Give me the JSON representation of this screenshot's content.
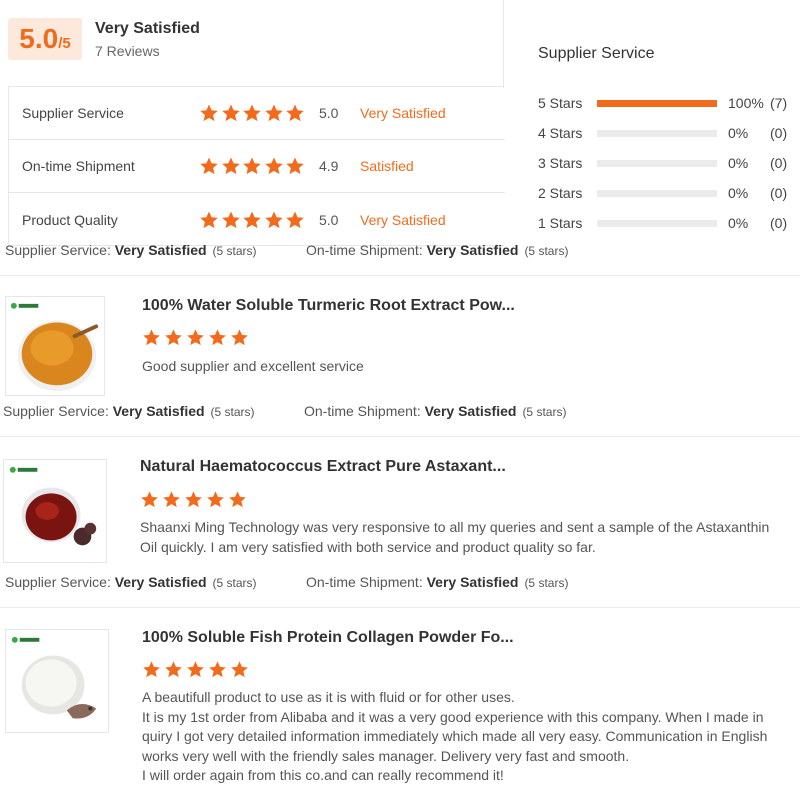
{
  "summary": {
    "score": "5.0",
    "out_of": "/5",
    "overall_label": "Very Satisfied",
    "reviews_count": "7 Reviews"
  },
  "ratings": [
    {
      "label": "Supplier Service",
      "score": "5.0",
      "status": "Very Satisfied",
      "stars": 5
    },
    {
      "label": "On-time Shipment",
      "score": "4.9",
      "status": "Satisfied",
      "stars": 5
    },
    {
      "label": "Product Quality",
      "score": "5.0",
      "status": "Very Satisfied",
      "stars": 5
    }
  ],
  "distribution": {
    "title": "Supplier Service",
    "rows": [
      {
        "label": "5 Stars",
        "fraction": 1.0,
        "pct": "100%",
        "count": "(7)"
      },
      {
        "label": "4 Stars",
        "fraction": 0.0,
        "pct": "0%",
        "count": "(0)"
      },
      {
        "label": "3 Stars",
        "fraction": 0.0,
        "pct": "0%",
        "count": "(0)"
      },
      {
        "label": "2 Stars",
        "fraction": 0.0,
        "pct": "0%",
        "count": "(0)"
      },
      {
        "label": "1 Stars",
        "fraction": 0.0,
        "pct": "0%",
        "count": "(0)"
      }
    ]
  },
  "service_line": {
    "supplier_label": "Supplier Service: ",
    "supplier_value": "Very Satisfied",
    "supplier_stars": "(5 stars)",
    "shipment_label": "On-time Shipment: ",
    "shipment_value": "Very Satisfied",
    "shipment_stars": "(5 stars)"
  },
  "reviews": [
    {
      "title": "100% Water Soluble Turmeric Root Extract Pow...",
      "stars": 5,
      "text_lines": [
        "Good supplier and excellent service"
      ],
      "supplier_value": "Very Satisfied",
      "supplier_stars": "(5 stars)",
      "shipment_value": "Very Satisfied",
      "shipment_stars": "(5 stars)"
    },
    {
      "title": "Natural Haematococcus Extract Pure Astaxant...",
      "stars": 5,
      "text_lines": [
        "Shaanxi Ming Technology was very responsive to all my queries and sent a sample of the Astaxanthin",
        "Oil quickly. I am very satisfied with both service and product quality so far."
      ],
      "supplier_value": "Very Satisfied",
      "supplier_stars": "(5 stars)",
      "shipment_value": "Very Satisfied",
      "shipment_stars": "(5 stars)"
    },
    {
      "title": "100% Soluble Fish Protein Collagen Powder Fo...",
      "stars": 5,
      "text_lines": [
        "A beautifull product to use as it is with fluid or for other uses.",
        "It is my 1st order from Alibaba and it was a very good experience with this company. When I made in",
        "quiry I got very detailed information immediately which made all very easy. Communication in English",
        "works very well with the friendly sales manager. Delivery very fast and smooth.",
        "I will order again from this co.and can really recommend it!"
      ]
    }
  ],
  "colors": {
    "accent": "#f26b1d",
    "score_bg": "#fde8dc",
    "track": "#ebebeb"
  }
}
